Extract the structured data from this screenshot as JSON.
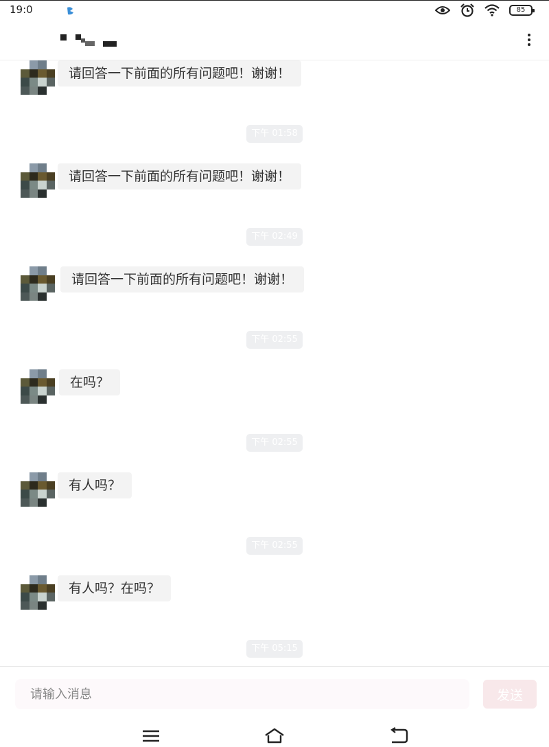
{
  "status_bar": {
    "time": "19:0",
    "battery": "85",
    "icons": [
      "app-notification-icon",
      "eye-icon",
      "alarm-icon",
      "wifi-icon",
      "battery-icon"
    ]
  },
  "header": {
    "contact_name": "",
    "menu_icon": "more-vertical-icon"
  },
  "messages": [
    {
      "type": "incoming",
      "text": "请回答一下前面的所有问题吧！谢谢！"
    },
    {
      "type": "time",
      "text": "下午 01:58"
    },
    {
      "type": "incoming",
      "text": "请回答一下前面的所有问题吧！谢谢！"
    },
    {
      "type": "time",
      "text": "下午 02:49"
    },
    {
      "type": "incoming",
      "text": "请回答一下前面的所有问题吧！谢谢！"
    },
    {
      "type": "time",
      "text": "下午 02:55"
    },
    {
      "type": "incoming",
      "text": "在吗？"
    },
    {
      "type": "time",
      "text": "下午 02:55"
    },
    {
      "type": "incoming",
      "text": "有人吗？"
    },
    {
      "type": "time",
      "text": "下午 02:55"
    },
    {
      "type": "incoming",
      "text": "有人吗？在吗？"
    },
    {
      "type": "time",
      "text": "下午 05:15"
    }
  ],
  "composer": {
    "placeholder": "请输入消息",
    "send_label": "发送"
  },
  "nav_bar": {
    "icons": [
      "menu-icon",
      "home-icon",
      "back-icon"
    ]
  },
  "colors": {
    "bubble_bg": "#f3f3f3",
    "timestamp_bg": "#eeeff1",
    "send_button_bg": "#f8e8ea",
    "input_bg": "#fdf9fb"
  }
}
